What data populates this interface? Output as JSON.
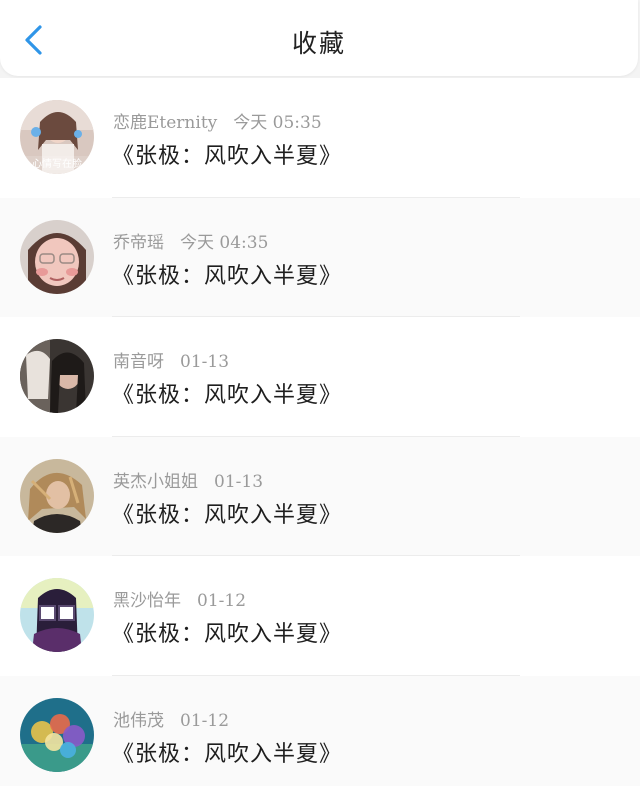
{
  "header": {
    "title": "收藏",
    "back_icon": "chevron-left-icon",
    "accent_color": "#2f95e8"
  },
  "favorites": [
    {
      "user": "恋鹿Eternity",
      "time": "今天 05:35",
      "song": "《张极：风吹入半夏》",
      "avatar_overlay": "心情写在脸"
    },
    {
      "user": "乔帝瑶",
      "time": "今天 04:35",
      "song": "《张极：风吹入半夏》"
    },
    {
      "user": "南音呀",
      "time": "01-13",
      "song": "《张极：风吹入半夏》"
    },
    {
      "user": "英杰小姐姐",
      "time": "01-13",
      "song": "《张极：风吹入半夏》"
    },
    {
      "user": "黑沙怡年",
      "time": "01-12",
      "song": "《张极：风吹入半夏》"
    },
    {
      "user": "池伟茂",
      "time": "01-12",
      "song": "《张极：风吹入半夏》"
    }
  ]
}
